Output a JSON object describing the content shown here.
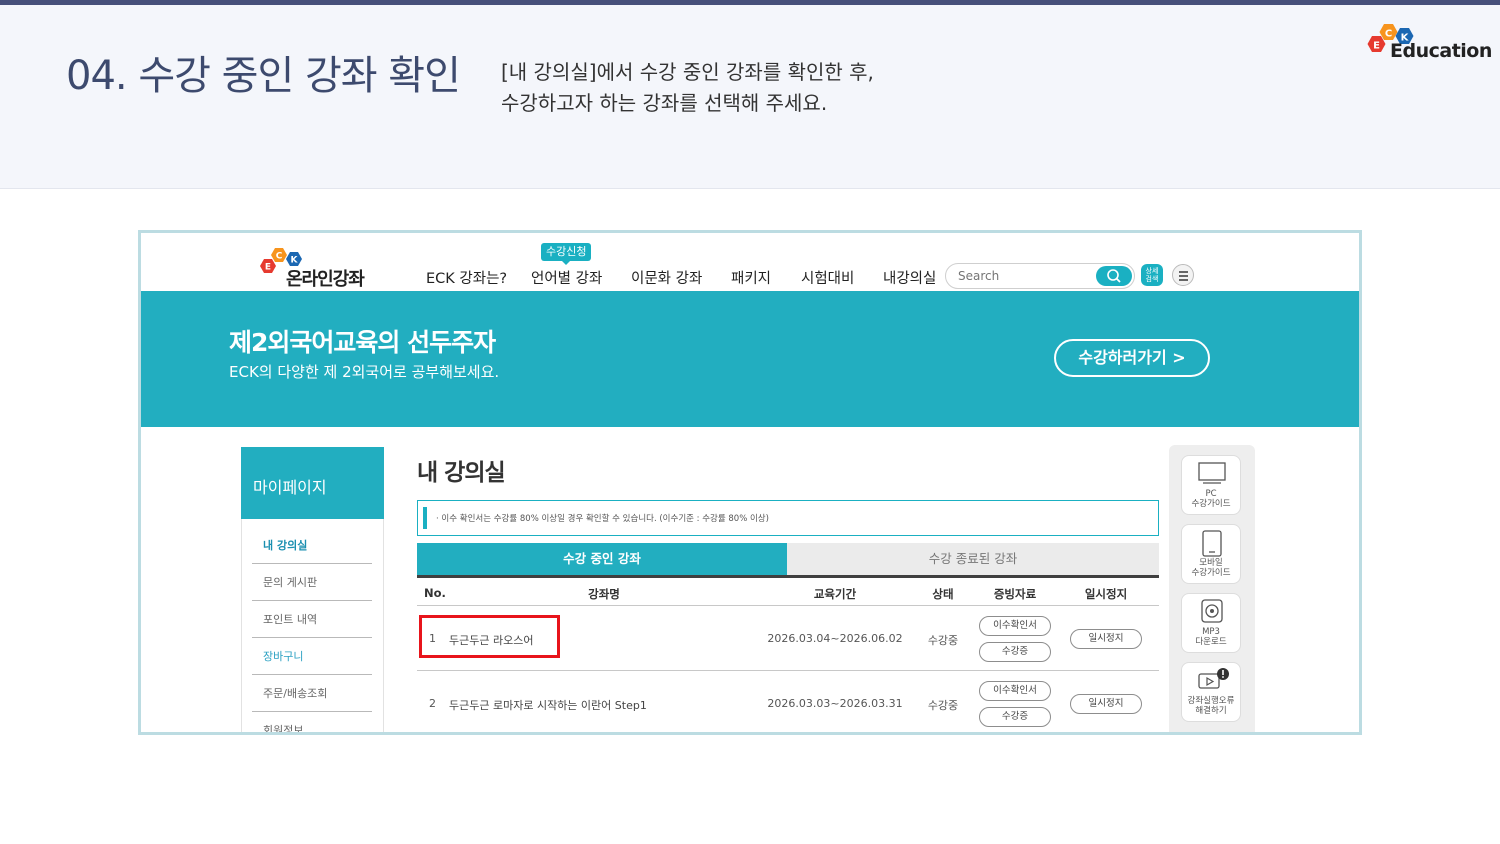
{
  "slide": {
    "title": "04. 수강 중인 강좌 확인",
    "description_line1": "[내 강의실]에서 수강 중인 강좌를 확인한 후,",
    "description_line2": "수강하고자 하는 강좌를 선택해 주세요.",
    "brand": "Education",
    "logo_letters": [
      "E",
      "C",
      "K"
    ]
  },
  "site": {
    "logo_text": "온라인강좌",
    "menu": [
      "ECK 강좌는?",
      "언어별 강좌",
      "이문화 강좌",
      "패키지",
      "시험대비",
      "내강의실"
    ],
    "menu_badge": "수강신청",
    "search_placeholder": "Search",
    "detail_search_label": "상세\n검색"
  },
  "hero": {
    "title": "제2외국어교육의 선두주자",
    "subtitle": "ECK의 다양한 제 2외국어로 공부해보세요.",
    "cta": "수강하러가기  >"
  },
  "sidebar": {
    "header": "마이페이지",
    "items": [
      "내 강의실",
      "문의 게시판",
      "포인트 내역",
      "장바구니",
      "주문/배송조회",
      "회원정보"
    ]
  },
  "main": {
    "title": "내 강의실",
    "notice": "·  이수 확인서는 수강률 80% 이상일 경우 확인할 수 있습니다. (이수기준 : 수강률 80% 이상)",
    "tabs": [
      "수강 중인 강좌",
      "수강 종료된 강좌"
    ],
    "columns": [
      "No.",
      "강좌명",
      "교육기간",
      "상태",
      "증빙자료",
      "일시정지"
    ],
    "rows": [
      {
        "no": "1",
        "name": "두근두근 라오스어",
        "period": "2026.03.04~2026.06.02",
        "status": "수강중",
        "doc1": "이수확인서",
        "doc2": "수강증",
        "pause": "일시정지"
      },
      {
        "no": "2",
        "name": "두근두근 로마자로 시작하는 이란어 Step1",
        "period": "2026.03.03~2026.03.31",
        "status": "수강중",
        "doc1": "이수확인서",
        "doc2": "수강증",
        "pause": "일시정지"
      }
    ]
  },
  "quick_menu": [
    {
      "label": "PC\n수강가이드",
      "icon": "monitor-icon"
    },
    {
      "label": "모바일\n수강가이드",
      "icon": "tablet-icon"
    },
    {
      "label": "MP3\n다운로드",
      "icon": "speaker-icon"
    },
    {
      "label": "강좌실행오류\n해결하기",
      "icon": "play-error-icon"
    }
  ],
  "colors": {
    "accent": "#22aec0",
    "highlight": "#e8141b",
    "title": "#3d4a6e",
    "top_bar": "#46507a"
  }
}
